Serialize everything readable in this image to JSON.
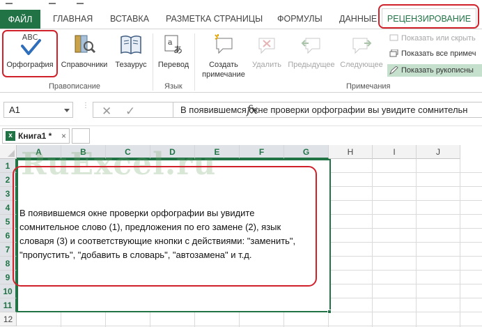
{
  "ribbon_tabs": {
    "file": "ФАЙЛ",
    "home": "ГЛАВНАЯ",
    "insert": "ВСТАВКА",
    "page_layout": "РАЗМЕТКА СТРАНИЦЫ",
    "formulas": "ФОРМУЛЫ",
    "data": "ДАННЫЕ",
    "review": "РЕЦЕНЗИРОВАНИЕ"
  },
  "ribbon": {
    "proofing": {
      "spelling": "Орфография",
      "research": "Справочники",
      "thesaurus": "Тезаурус",
      "group_label": "Правописание",
      "spelling_icon_text": "ABC"
    },
    "language": {
      "translate": "Перевод",
      "group_label": "Язык"
    },
    "comments": {
      "new_comment_line1": "Создать",
      "new_comment_line2": "примечание",
      "delete": "Удалить",
      "previous": "Предыдущее",
      "next": "Следующее",
      "show_hide": "Показать или скрыть",
      "show_all": "Показать все примеч",
      "show_ink": "Показать рукописны",
      "group_label": "Примечания"
    }
  },
  "formula_bar": {
    "name_box": "A1",
    "fx": "fx",
    "content": "В появившемся окне проверки орфографии вы увидите сомнительн"
  },
  "workbook_tab": {
    "name": "Книга1 *",
    "close": "×"
  },
  "columns": [
    "A",
    "B",
    "C",
    "D",
    "E",
    "F",
    "G",
    "H",
    "I",
    "J"
  ],
  "rows": [
    "1",
    "2",
    "3",
    "4",
    "5",
    "6",
    "7",
    "8",
    "9",
    "10",
    "11",
    "12"
  ],
  "watermark": "RuExcel.ru",
  "cell_text_lines": [
    "В появившемся окне проверки орфографии вы увидите",
    "сомнительное слово (1), предложения по его замене (2), язык",
    "словаря (3) и соответствующие кнопки с действиями: \"заменить\",",
    "\"пропустить\", \"добавить в словарь\", \"автозамена\" и т.д."
  ],
  "colors": {
    "accent": "#217346",
    "highlight": "#d0212b"
  }
}
